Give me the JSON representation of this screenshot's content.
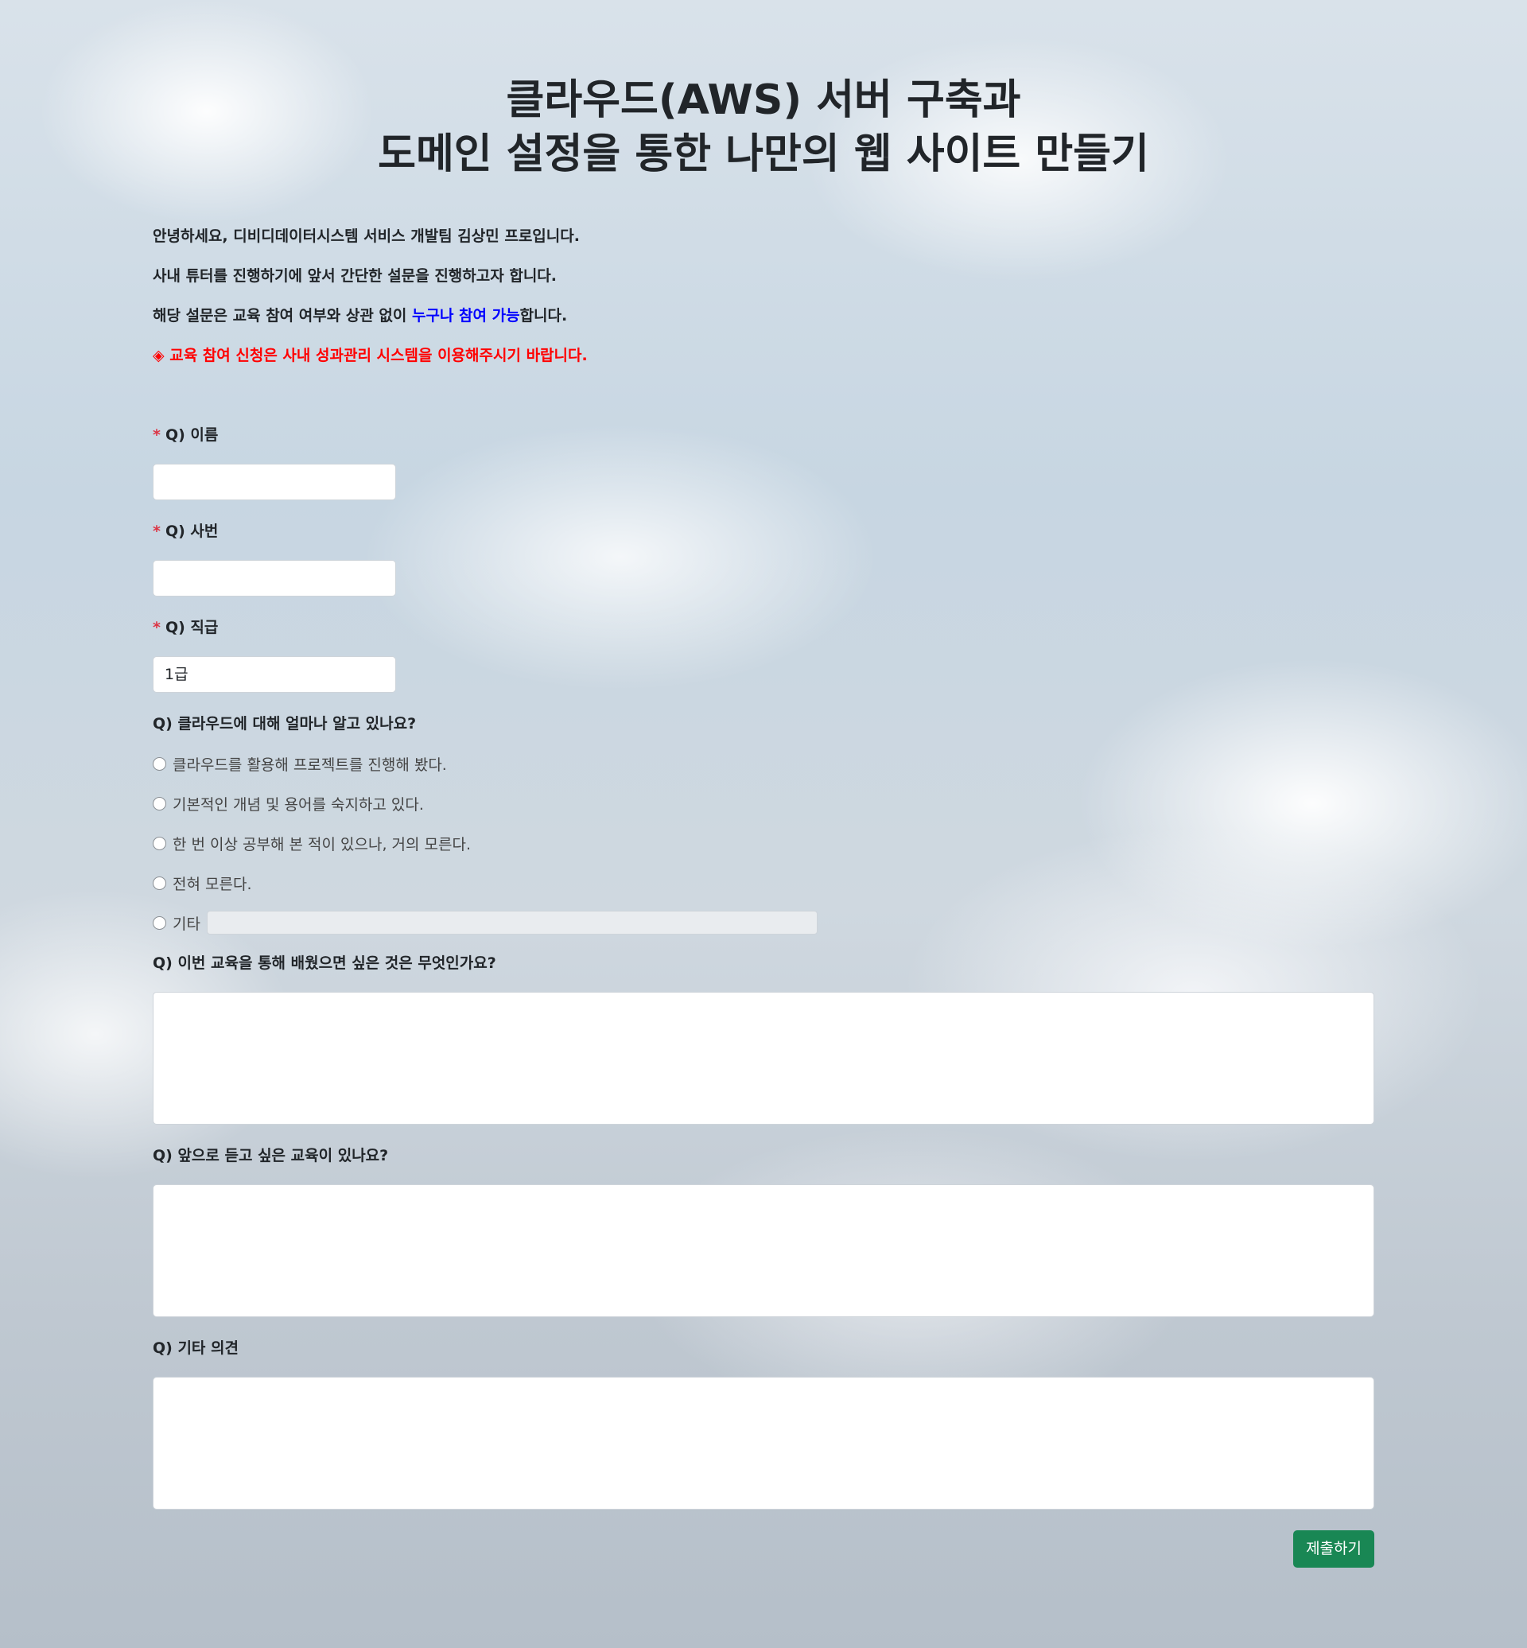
{
  "header": {
    "title_line1": "클라우드(AWS) 서버 구축과",
    "title_line2": "도메인 설정을 통한 나만의 웹 사이트 만들기"
  },
  "intro": {
    "line1": "안녕하세요, 디비디데이터시스템 서비스 개발팀 김상민 프로입니다.",
    "line2": "사내 튜터를 진행하기에 앞서 간단한 설문을 진행하고자 합니다.",
    "line3_prefix": "해당 설문은 교육 참여 여부와 상관 없이 ",
    "line3_highlight": "누구나 참여 가능",
    "line3_suffix": "합니다.",
    "notice": "◈ 교육 참여 신청은 사내 성과관리 시스템을 이용해주시기 바랍니다."
  },
  "form": {
    "required_mark": "*",
    "name": {
      "label": "Q) 이름",
      "value": ""
    },
    "employee_id": {
      "label": "Q) 사번",
      "value": ""
    },
    "position": {
      "label": "Q) 직급",
      "value": "1급"
    },
    "cloud_knowledge": {
      "label": "Q) 클라우드에 대해 얼마나 알고 있나요?",
      "options": [
        "클라우드를 활용해 프로젝트를 진행해 봤다.",
        "기본적인 개념 및 용어를 숙지하고 있다.",
        "한 번 이상 공부해 본 적이 있으나, 거의 모른다.",
        "전혀 모른다.",
        "기타"
      ]
    },
    "want_to_learn": {
      "label": "Q) 이번 교육을 통해 배웠으면 싶은 것은 무엇인가요?"
    },
    "future_topics": {
      "label": "Q) 앞으로 듣고 싶은 교육이 있나요?"
    },
    "other_opinions": {
      "label": "Q) 기타 의견"
    },
    "submit_label": "제출하기"
  },
  "colors": {
    "highlight_blue": "#0000ff",
    "notice_red": "#ff0000",
    "required_red": "#dc3545",
    "submit_green": "#198754"
  }
}
